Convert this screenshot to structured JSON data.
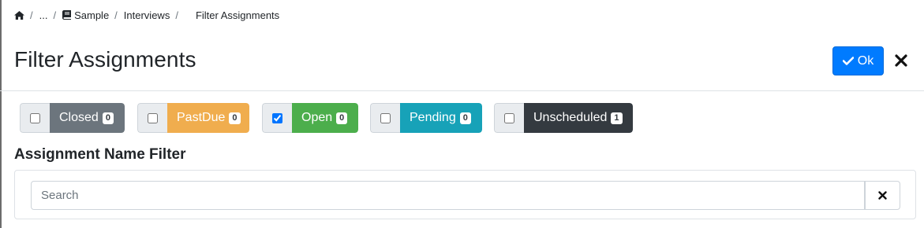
{
  "breadcrumb": {
    "home_icon": "home-icon",
    "separator": "/",
    "ellipsis": "...",
    "book_icon": "book-icon",
    "items": [
      "Sample",
      "Interviews",
      "Filter Assignments"
    ]
  },
  "header": {
    "title": "Filter Assignments",
    "ok_label": "Ok",
    "ok_icon": "check-icon",
    "close_icon": "close-icon"
  },
  "status_filters": [
    {
      "label": "Closed",
      "count": "0",
      "checked": false,
      "color": "#6c757d"
    },
    {
      "label": "PastDue",
      "count": "0",
      "checked": false,
      "color": "#f0ad4e"
    },
    {
      "label": "Open",
      "count": "0",
      "checked": true,
      "color": "#4cae4c"
    },
    {
      "label": "Pending",
      "count": "0",
      "checked": false,
      "color": "#17a2b8"
    },
    {
      "label": "Unscheduled",
      "count": "1",
      "checked": false,
      "color": "#343a40"
    }
  ],
  "name_filter": {
    "heading": "Assignment Name Filter",
    "placeholder": "Search",
    "value": "",
    "clear_icon": "close-icon"
  },
  "colors": {
    "primary": "#007bff",
    "divider": "#dee2e6"
  }
}
